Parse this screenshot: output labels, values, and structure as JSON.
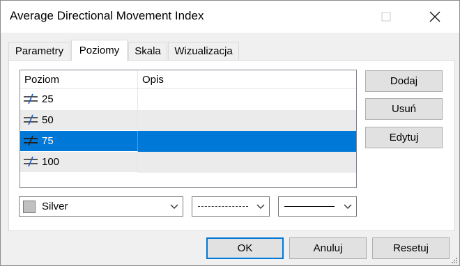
{
  "window": {
    "title": "Average Directional Movement Index"
  },
  "tabs": [
    {
      "label": "Parametry",
      "active": false
    },
    {
      "label": "Poziomy",
      "active": true
    },
    {
      "label": "Skala",
      "active": false
    },
    {
      "label": "Wizualizacja",
      "active": false
    }
  ],
  "levels": {
    "columns": [
      "Poziom",
      "Opis"
    ],
    "rows": [
      {
        "value": "25",
        "description": "",
        "selected": false
      },
      {
        "value": "50",
        "description": "",
        "selected": false
      },
      {
        "value": "75",
        "description": "",
        "selected": true
      },
      {
        "value": "100",
        "description": "",
        "selected": false
      }
    ]
  },
  "side_buttons": {
    "add": "Dodaj",
    "remove": "Usuń",
    "edit": "Edytuj"
  },
  "style": {
    "color_name": "Silver",
    "color_hex": "#c0c0c0",
    "line_style": "dotted",
    "line_width": "thin"
  },
  "footer": {
    "ok": "OK",
    "cancel": "Anuluj",
    "reset": "Resetuj"
  },
  "icons": {
    "minimize": "minimize-icon",
    "maximize": "maximize-icon",
    "close": "close-icon",
    "level": "level-line-icon",
    "dropdown": "chevron-down-icon"
  },
  "colors": {
    "selection": "#0078d7",
    "alt_row": "#ebebeb"
  }
}
